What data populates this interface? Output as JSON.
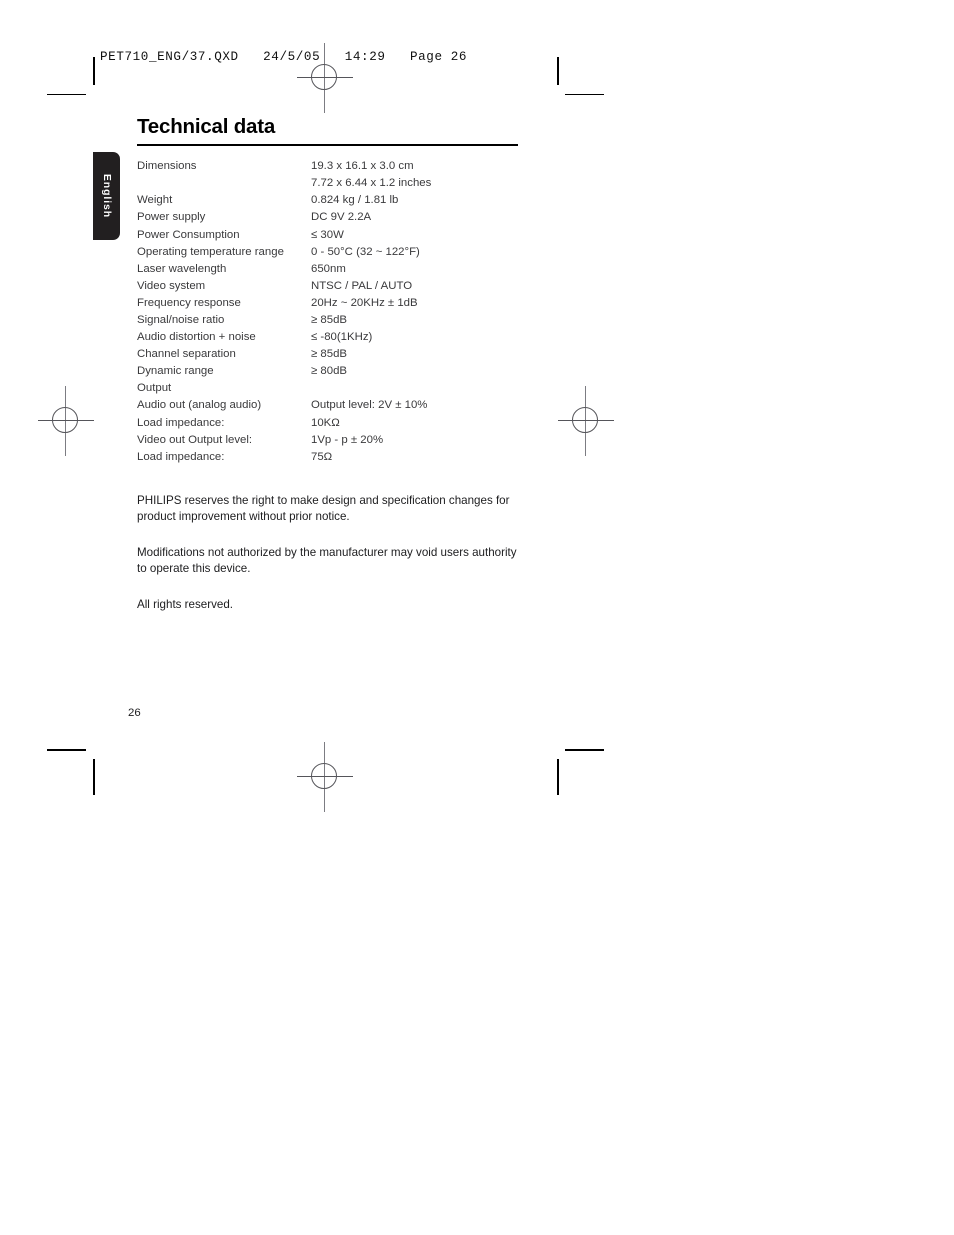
{
  "file_header": "PET710_ENG/37.QXD   24/5/05   14:29   Page 26",
  "side_tab": {
    "label": "English"
  },
  "title": "Technical data",
  "spec_table": {
    "rows": [
      {
        "label": "Dimensions",
        "value": "19.3 x 16.1 x 3.0 cm"
      },
      {
        "label": "",
        "value": "7.72 x 6.44 x 1.2 inches"
      },
      {
        "label": "Weight",
        "value": "0.824 kg / 1.81 lb"
      },
      {
        "label": "Power supply",
        "value": "DC 9V 2.2A"
      },
      {
        "label": "Power Consumption",
        "value": "≤ 30W"
      },
      {
        "label": "Operating temperature range",
        "value": "0 - 50°C (32 ~ 122°F)"
      },
      {
        "label": "Laser wavelength",
        "value": "650nm"
      },
      {
        "label": "Video system",
        "value": "NTSC / PAL / AUTO"
      },
      {
        "label": "Frequency response",
        "value": "20Hz ~ 20KHz ± 1dB"
      },
      {
        "label": "Signal/noise ratio",
        "value": "≥ 85dB"
      },
      {
        "label": "Audio distortion + noise",
        "value": "≤ -80(1KHz)"
      },
      {
        "label": "Channel separation",
        "value": "≥ 85dB"
      },
      {
        "label": "Dynamic range",
        "value": "≥ 80dB"
      },
      {
        "label": "Output",
        "value": ""
      },
      {
        "label": "Audio out (analog audio)",
        "value": "Output level: 2V ± 10%"
      },
      {
        "label": "Load impedance:",
        "value": "10KΩ"
      },
      {
        "label": "Video out Output level:",
        "value": "1Vp - p ± 20%"
      },
      {
        "label": "Load impedance:",
        "value": "75Ω"
      }
    ]
  },
  "notes": {
    "note_1": "PHILIPS reserves the right to make design and specification changes for product improvement without prior notice.",
    "note_2": "Modifications not authorized by the manufacturer may void users authority to operate this device.",
    "note_3": "All rights reserved."
  },
  "page_number": "26",
  "colors": {
    "tab_background": "#221f20",
    "body_text": "#3a3a3c",
    "rule": "#000000"
  }
}
